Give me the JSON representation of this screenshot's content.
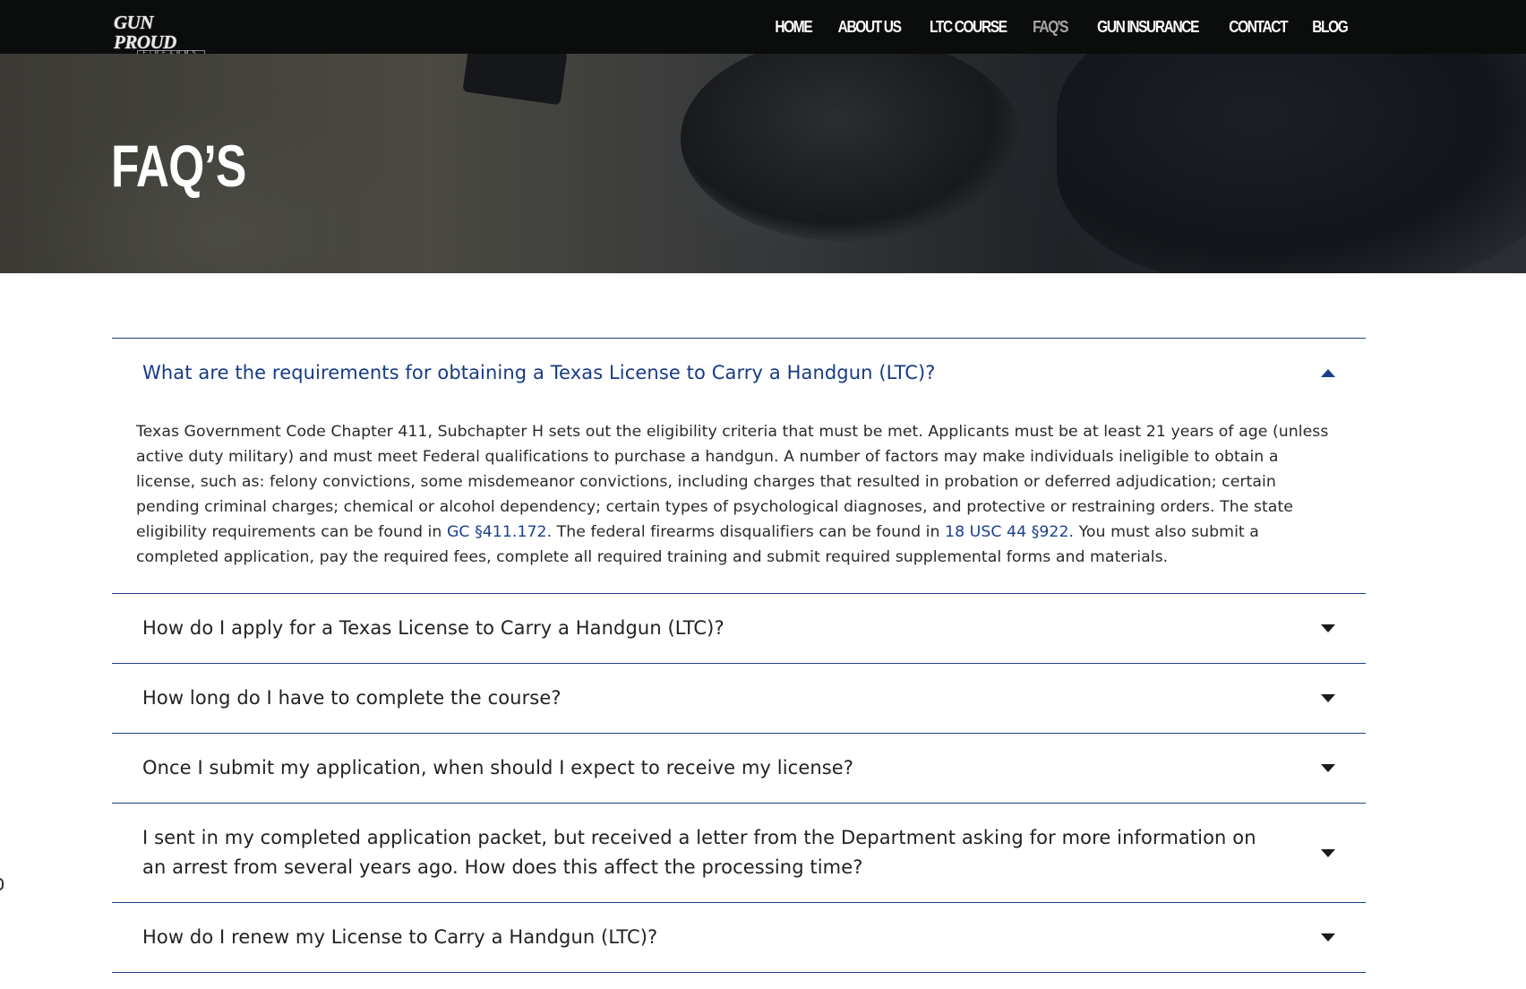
{
  "logo": {
    "word": "GUN PROUD",
    "sub": "FIREARMS"
  },
  "nav": {
    "items": [
      {
        "label": "HOME",
        "active": false
      },
      {
        "label": "ABOUT US",
        "active": false
      },
      {
        "label": "LTC COURSE",
        "active": false
      },
      {
        "label": "FAQ'S",
        "active": true
      },
      {
        "label": "GUN INSURANCE",
        "active": false
      },
      {
        "label": "CONTACT",
        "active": false
      },
      {
        "label": "BLOG",
        "active": false
      }
    ]
  },
  "hero": {
    "title": "FAQ’S"
  },
  "faq": {
    "items": [
      {
        "question": "What are the requirements for obtaining a Texas License to Carry a Handgun (LTC)?",
        "expanded": true,
        "answer_part1": "Texas Government Code Chapter 411, Subchapter H sets out the eligibility criteria that must be met. Applicants must be at least 21 years of age (unless active duty military) and must meet Federal qualifications to purchase a handgun. A number of factors may make individuals ineligible to obtain a license, such as: felony convictions, some misdemeanor convictions, including charges that resulted in probation or deferred adjudication; certain pending criminal charges; chemical or alcohol dependency; certain types of psychological diagnoses, and protective or restraining orders. The state eligibility requirements can be found in ",
        "link1": "GC §411.172.",
        "answer_part2": " The federal firearms disqualifiers can be found in ",
        "link2": "18 USC 44 §922.",
        "answer_part3": " You must also submit a completed application, pay the required fees, complete all required training and submit required supplemental forms and materials."
      },
      {
        "question": "How do I apply for a Texas License to Carry a Handgun (LTC)?",
        "expanded": false
      },
      {
        "question": "How long do I have to complete the course?",
        "expanded": false
      },
      {
        "question": "Once I submit my application, when should I expect to receive my license?",
        "expanded": false
      },
      {
        "question": "I sent in my completed application packet, but received a letter from the Department asking for more information on an arrest from several years ago. How does this affect the processing time?",
        "expanded": false
      },
      {
        "question": "How do I renew my License to Carry a Handgun (LTC)?",
        "expanded": false
      }
    ]
  },
  "colors": {
    "nav_bg": "#0b0c0c",
    "accent_blue": "#173a86",
    "divider": "#1e3e8a"
  },
  "icons": {
    "expanded": "caret-up-icon",
    "collapsed": "caret-down-icon"
  }
}
